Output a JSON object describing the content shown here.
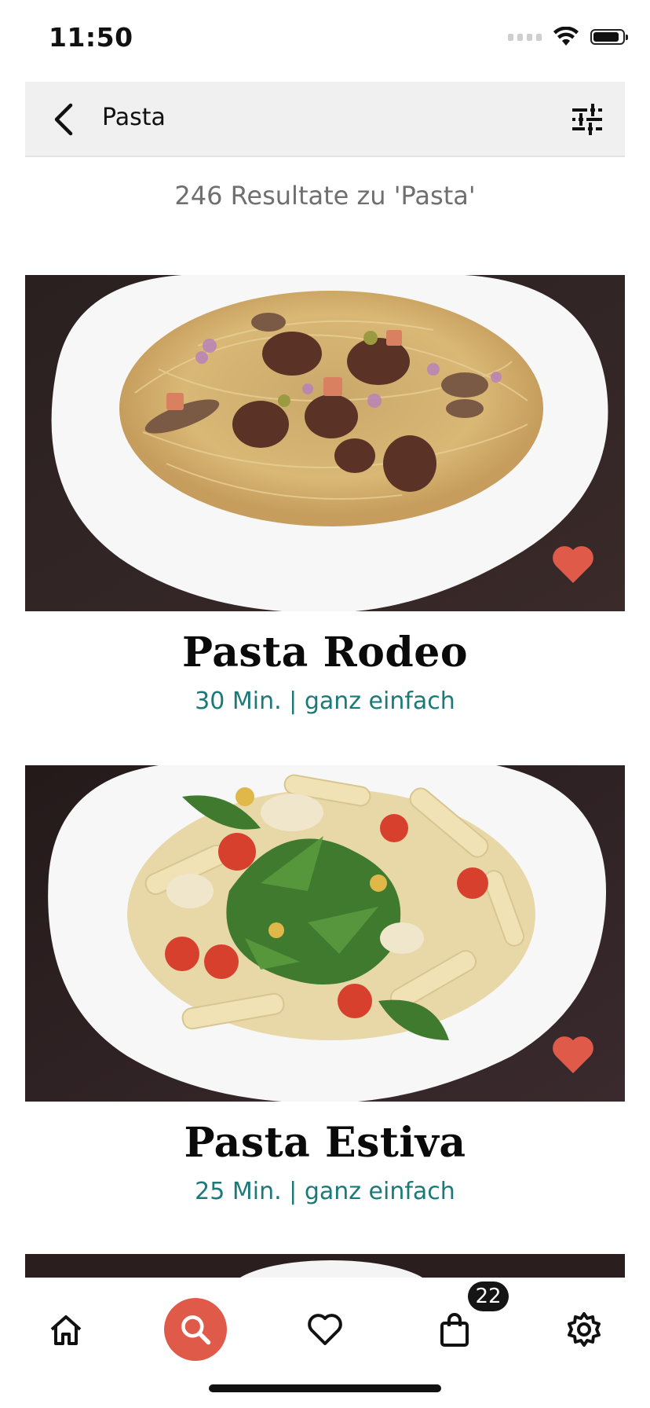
{
  "status_bar": {
    "time": "11:50"
  },
  "header": {
    "title": "Pasta",
    "back_icon": "chevron-left-icon",
    "filter_icon": "sliders-icon"
  },
  "results": {
    "count_text": "246 Resultate zu 'Pasta'"
  },
  "recipes": [
    {
      "title": "Pasta Rodeo",
      "meta": "30 Min. | ganz einfach",
      "favorite": true
    },
    {
      "title": "Pasta Estiva",
      "meta": "25 Min. | ganz einfach",
      "favorite": true
    }
  ],
  "tab_bar": {
    "tabs": [
      "home-icon",
      "search-icon",
      "heart-icon",
      "shopping-bag-icon",
      "gear-icon"
    ],
    "active": "search-icon",
    "cart_badge": "22"
  },
  "colors": {
    "accent": "#e05a4a",
    "meta": "#1b7a78",
    "header_bg": "#f0f0f0"
  }
}
